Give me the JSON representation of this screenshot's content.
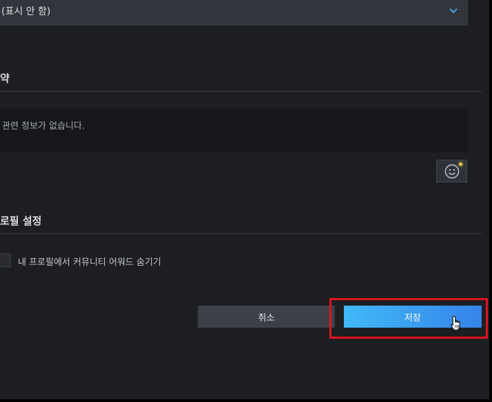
{
  "visibility": {
    "selected_value": "(표시 안 함)",
    "chevron_icon": "chevron-down-icon"
  },
  "summary": {
    "title": "약",
    "text": "관련 정보가 없습니다.",
    "emoji_icon": "smiley-icon"
  },
  "profile_settings": {
    "title": "로필 설정",
    "hide_awards_label": "내 프로필에서 커뮤니티 어워드 숨기기",
    "hide_awards_checked": false
  },
  "actions": {
    "cancel_label": "취소",
    "save_label": "저장"
  },
  "colors": {
    "background": "#1d1e22",
    "accent": "#3fa6f5",
    "highlight": "#e0141d"
  }
}
